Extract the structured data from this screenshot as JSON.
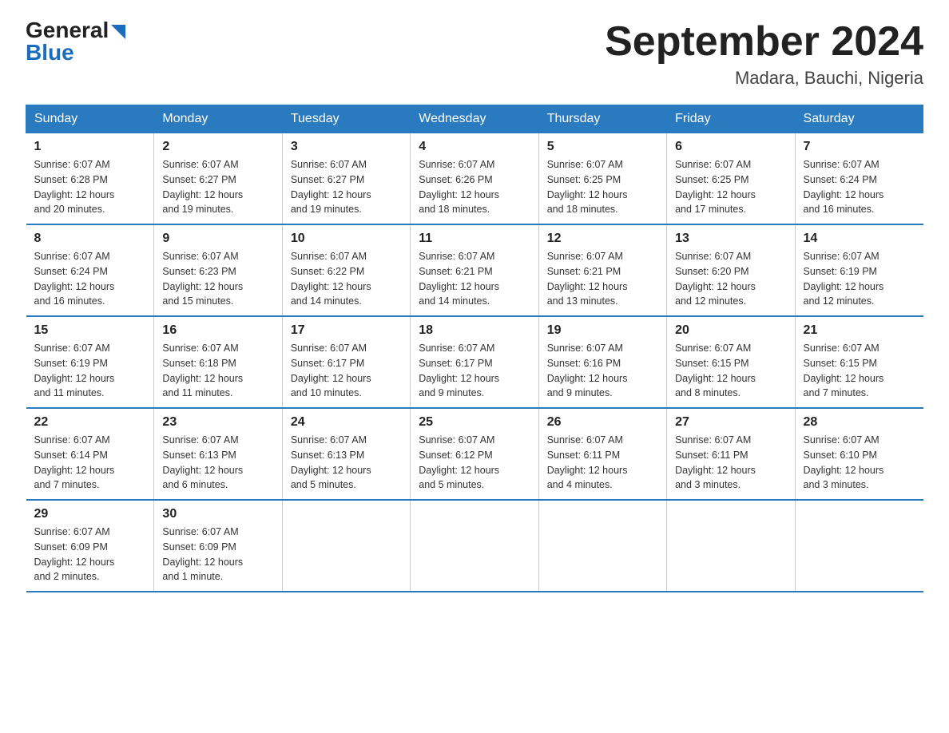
{
  "header": {
    "logo_general": "General",
    "logo_blue": "Blue",
    "title": "September 2024",
    "location": "Madara, Bauchi, Nigeria"
  },
  "calendar": {
    "weekdays": [
      "Sunday",
      "Monday",
      "Tuesday",
      "Wednesday",
      "Thursday",
      "Friday",
      "Saturday"
    ],
    "weeks": [
      [
        {
          "day": "1",
          "sunrise": "6:07 AM",
          "sunset": "6:28 PM",
          "daylight": "12 hours and 20 minutes."
        },
        {
          "day": "2",
          "sunrise": "6:07 AM",
          "sunset": "6:27 PM",
          "daylight": "12 hours and 19 minutes."
        },
        {
          "day": "3",
          "sunrise": "6:07 AM",
          "sunset": "6:27 PM",
          "daylight": "12 hours and 19 minutes."
        },
        {
          "day": "4",
          "sunrise": "6:07 AM",
          "sunset": "6:26 PM",
          "daylight": "12 hours and 18 minutes."
        },
        {
          "day": "5",
          "sunrise": "6:07 AM",
          "sunset": "6:25 PM",
          "daylight": "12 hours and 18 minutes."
        },
        {
          "day": "6",
          "sunrise": "6:07 AM",
          "sunset": "6:25 PM",
          "daylight": "12 hours and 17 minutes."
        },
        {
          "day": "7",
          "sunrise": "6:07 AM",
          "sunset": "6:24 PM",
          "daylight": "12 hours and 16 minutes."
        }
      ],
      [
        {
          "day": "8",
          "sunrise": "6:07 AM",
          "sunset": "6:24 PM",
          "daylight": "12 hours and 16 minutes."
        },
        {
          "day": "9",
          "sunrise": "6:07 AM",
          "sunset": "6:23 PM",
          "daylight": "12 hours and 15 minutes."
        },
        {
          "day": "10",
          "sunrise": "6:07 AM",
          "sunset": "6:22 PM",
          "daylight": "12 hours and 14 minutes."
        },
        {
          "day": "11",
          "sunrise": "6:07 AM",
          "sunset": "6:21 PM",
          "daylight": "12 hours and 14 minutes."
        },
        {
          "day": "12",
          "sunrise": "6:07 AM",
          "sunset": "6:21 PM",
          "daylight": "12 hours and 13 minutes."
        },
        {
          "day": "13",
          "sunrise": "6:07 AM",
          "sunset": "6:20 PM",
          "daylight": "12 hours and 12 minutes."
        },
        {
          "day": "14",
          "sunrise": "6:07 AM",
          "sunset": "6:19 PM",
          "daylight": "12 hours and 12 minutes."
        }
      ],
      [
        {
          "day": "15",
          "sunrise": "6:07 AM",
          "sunset": "6:19 PM",
          "daylight": "12 hours and 11 minutes."
        },
        {
          "day": "16",
          "sunrise": "6:07 AM",
          "sunset": "6:18 PM",
          "daylight": "12 hours and 11 minutes."
        },
        {
          "day": "17",
          "sunrise": "6:07 AM",
          "sunset": "6:17 PM",
          "daylight": "12 hours and 10 minutes."
        },
        {
          "day": "18",
          "sunrise": "6:07 AM",
          "sunset": "6:17 PM",
          "daylight": "12 hours and 9 minutes."
        },
        {
          "day": "19",
          "sunrise": "6:07 AM",
          "sunset": "6:16 PM",
          "daylight": "12 hours and 9 minutes."
        },
        {
          "day": "20",
          "sunrise": "6:07 AM",
          "sunset": "6:15 PM",
          "daylight": "12 hours and 8 minutes."
        },
        {
          "day": "21",
          "sunrise": "6:07 AM",
          "sunset": "6:15 PM",
          "daylight": "12 hours and 7 minutes."
        }
      ],
      [
        {
          "day": "22",
          "sunrise": "6:07 AM",
          "sunset": "6:14 PM",
          "daylight": "12 hours and 7 minutes."
        },
        {
          "day": "23",
          "sunrise": "6:07 AM",
          "sunset": "6:13 PM",
          "daylight": "12 hours and 6 minutes."
        },
        {
          "day": "24",
          "sunrise": "6:07 AM",
          "sunset": "6:13 PM",
          "daylight": "12 hours and 5 minutes."
        },
        {
          "day": "25",
          "sunrise": "6:07 AM",
          "sunset": "6:12 PM",
          "daylight": "12 hours and 5 minutes."
        },
        {
          "day": "26",
          "sunrise": "6:07 AM",
          "sunset": "6:11 PM",
          "daylight": "12 hours and 4 minutes."
        },
        {
          "day": "27",
          "sunrise": "6:07 AM",
          "sunset": "6:11 PM",
          "daylight": "12 hours and 3 minutes."
        },
        {
          "day": "28",
          "sunrise": "6:07 AM",
          "sunset": "6:10 PM",
          "daylight": "12 hours and 3 minutes."
        }
      ],
      [
        {
          "day": "29",
          "sunrise": "6:07 AM",
          "sunset": "6:09 PM",
          "daylight": "12 hours and 2 minutes."
        },
        {
          "day": "30",
          "sunrise": "6:07 AM",
          "sunset": "6:09 PM",
          "daylight": "12 hours and 1 minute."
        },
        null,
        null,
        null,
        null,
        null
      ]
    ],
    "sunrise_label": "Sunrise:",
    "sunset_label": "Sunset:",
    "daylight_label": "Daylight:"
  }
}
